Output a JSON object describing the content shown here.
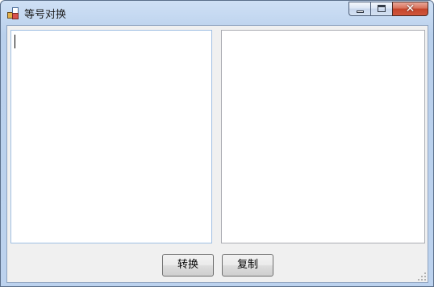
{
  "window": {
    "title": "等号对换",
    "close_glyph": "✕",
    "colors": {
      "titlebar": "#bcd2ee",
      "client": "#f0f0f0",
      "close_button": "#c4442a"
    }
  },
  "caption_buttons": {
    "minimize_icon": "minimize-icon",
    "maximize_icon": "maximize-icon",
    "close_icon": "close-icon"
  },
  "input_box": {
    "value": ""
  },
  "output_box": {
    "value": ""
  },
  "buttons": {
    "convert_label": "转换",
    "copy_label": "复制"
  }
}
